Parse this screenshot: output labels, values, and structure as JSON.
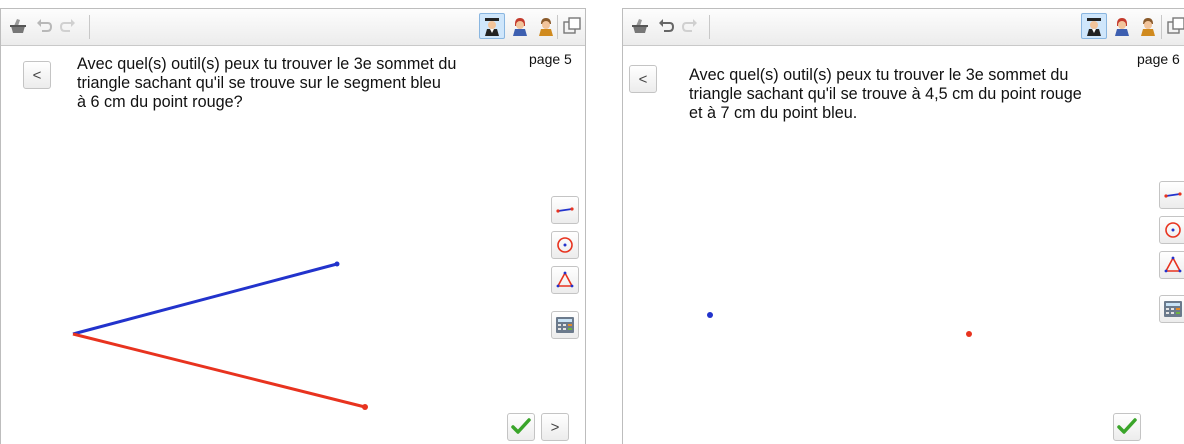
{
  "left_panel": {
    "page_label": "page 5",
    "question_lines": [
      "Avec quel(s) outil(s) peux tu trouver le 3e sommet du",
      "triangle sachant qu'il se trouve sur le segment bleu",
      "à 6 cm du point rouge?"
    ],
    "back_label": "<",
    "next_label": ">"
  },
  "right_panel": {
    "page_label": "page 6",
    "question_lines": [
      "Avec quel(s) outil(s) peux tu trouver le 3e sommet du",
      "triangle sachant qu'il se trouve à 4,5 cm du point rouge",
      "et à 7 cm du point bleu."
    ],
    "back_label": "<"
  },
  "colors": {
    "red_segment": "#e8331f",
    "blue_segment": "#2233cc",
    "check_green": "#3aa52a"
  },
  "icons": [
    "eraser-icon",
    "undo-icon",
    "redo-icon",
    "teacher-icon",
    "student-icon",
    "student-alt-icon",
    "popout-icon",
    "segment-tool-icon",
    "circle-tool-icon",
    "triangle-tool-icon",
    "calculator-icon",
    "checkmark-icon"
  ]
}
